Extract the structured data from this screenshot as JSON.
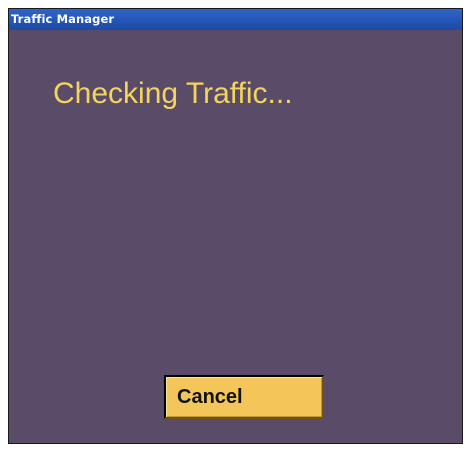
{
  "window": {
    "title": "Traffic Manager"
  },
  "main": {
    "status_text": "Checking Traffic..."
  },
  "actions": {
    "cancel_label": "Cancel"
  },
  "colors": {
    "titlebar": "#2456b6",
    "background": "#5a4b68",
    "status_text": "#f2d55a",
    "button": "#f4c65a"
  }
}
